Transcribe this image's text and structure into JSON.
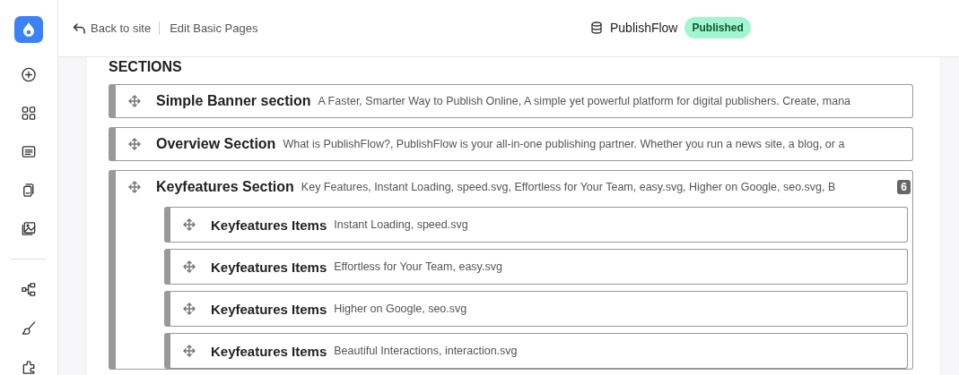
{
  "header": {
    "back_link": "Back to site",
    "breadcrumb": "Edit Basic Pages",
    "site_name": "PublishFlow",
    "status_badge": "Published"
  },
  "sections_heading": "SECTIONS",
  "sections": [
    {
      "title": "Simple Banner section",
      "summary": "A Faster, Smarter Way to Publish Online, A simple yet powerful platform for digital publishers. Create, mana"
    },
    {
      "title": "Overview Section",
      "summary": "What is PublishFlow?, PublishFlow is your all-in-one publishing partner. Whether you run a news site, a blog, or a"
    },
    {
      "title": "Keyfeatures Section",
      "summary": "Key Features, Instant Loading, speed.svg, Effortless for Your Team, easy.svg, Higher on Google, seo.svg, B",
      "count": "6",
      "children": [
        {
          "title": "Keyfeatures Items",
          "summary": "Instant Loading, speed.svg"
        },
        {
          "title": "Keyfeatures Items",
          "summary": "Effortless for Your Team, easy.svg"
        },
        {
          "title": "Keyfeatures Items",
          "summary": "Higher on Google, seo.svg"
        },
        {
          "title": "Keyfeatures Items",
          "summary": "Beautiful Interactions, interaction.svg"
        }
      ]
    }
  ]
}
